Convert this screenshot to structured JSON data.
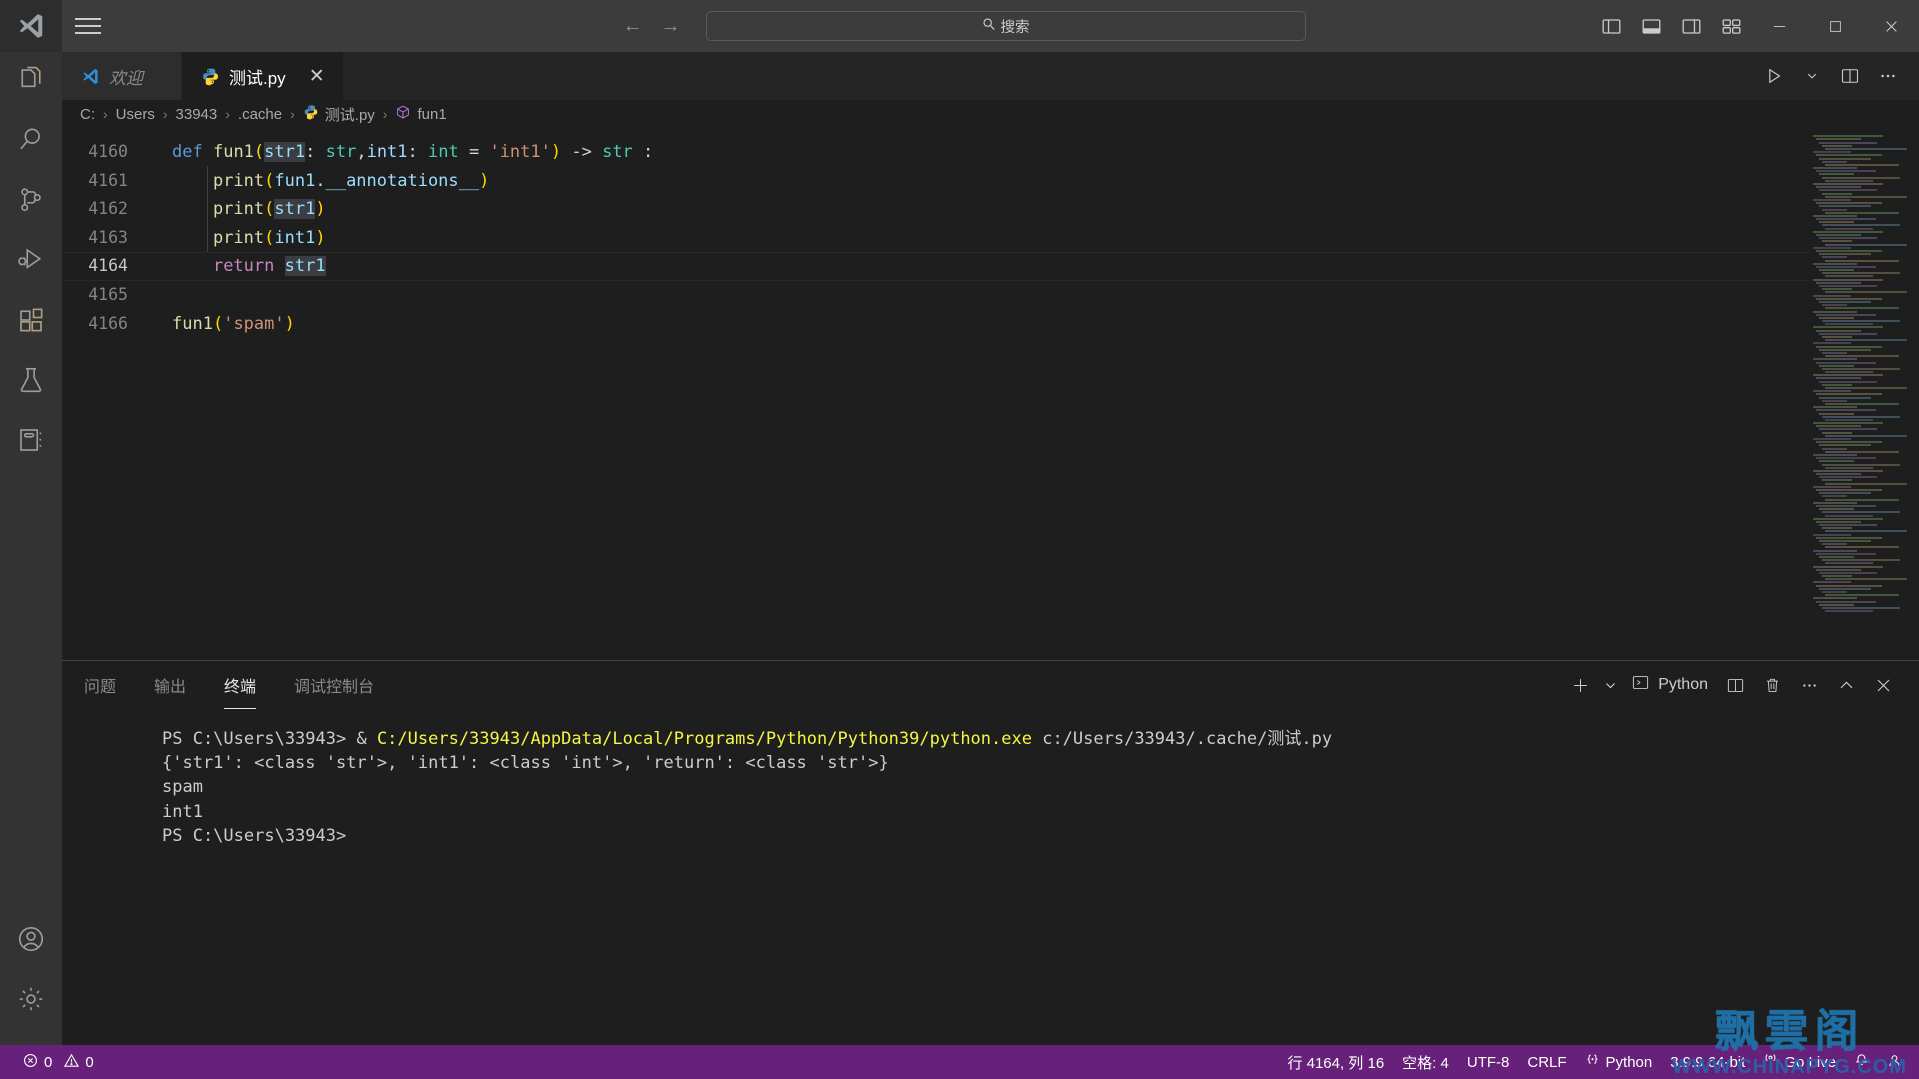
{
  "titlebar": {
    "logo_icon": "vscode-logo-icon",
    "menu_icon": "hamburger-menu-icon",
    "back_label": "←",
    "forward_label": "→",
    "search_placeholder": "搜索",
    "search_icon": "search-icon",
    "layout_icons": [
      "toggle-primary-sidebar-icon",
      "toggle-panel-icon",
      "toggle-secondary-sidebar-icon",
      "customize-layout-icon"
    ],
    "window_minimize": "minimize-icon",
    "window_maximize": "maximize-icon",
    "window_close": "close-icon"
  },
  "activitybar": {
    "items": [
      {
        "name": "explorer",
        "icon": "files-icon"
      },
      {
        "name": "search",
        "icon": "search-icon"
      },
      {
        "name": "source-control",
        "icon": "source-control-icon"
      },
      {
        "name": "run-and-debug",
        "icon": "run-debug-icon"
      },
      {
        "name": "extensions",
        "icon": "extensions-icon"
      },
      {
        "name": "testing",
        "icon": "beaker-icon"
      },
      {
        "name": "jupyter",
        "icon": "notebook-icon"
      }
    ],
    "bottom": [
      {
        "name": "accounts",
        "icon": "account-icon"
      },
      {
        "name": "manage",
        "icon": "gear-icon"
      }
    ]
  },
  "tabs": [
    {
      "label": "欢迎",
      "icon": "vscode-logo-icon",
      "active": false,
      "italic": true,
      "closable": false
    },
    {
      "label": "测试.py",
      "icon": "python-icon",
      "active": true,
      "italic": false,
      "closable": true,
      "close_label": "✕"
    }
  ],
  "editor_actions": {
    "run_label": "run-python-file-icon",
    "run_chevron": "chevron-down-icon",
    "split_editor": "split-editor-right-icon",
    "more_actions": "more-actions-icon"
  },
  "breadcrumb": {
    "items": [
      {
        "label": "C:",
        "icon": null
      },
      {
        "label": "Users",
        "icon": null
      },
      {
        "label": "33943",
        "icon": null
      },
      {
        "label": ".cache",
        "icon": null
      },
      {
        "label": "测试.py",
        "icon": "python-icon"
      },
      {
        "label": "fun1",
        "icon": "symbol-class-icon"
      }
    ],
    "separator": "›"
  },
  "editor": {
    "language": "python",
    "lines": [
      {
        "number": "4160",
        "current": false,
        "tokens": [
          {
            "t": "def",
            "c": "kw"
          },
          {
            "t": " ",
            "c": "op"
          },
          {
            "t": "fun1",
            "c": "fn"
          },
          {
            "t": "(",
            "c": "p1"
          },
          {
            "t": "str1",
            "c": "var sel"
          },
          {
            "t": ": ",
            "c": "op"
          },
          {
            "t": "str",
            "c": "type"
          },
          {
            "t": ",",
            "c": "op"
          },
          {
            "t": "int1",
            "c": "var"
          },
          {
            "t": ": ",
            "c": "op"
          },
          {
            "t": "int",
            "c": "type"
          },
          {
            "t": " = ",
            "c": "op"
          },
          {
            "t": "'int1'",
            "c": "str"
          },
          {
            "t": ")",
            "c": "p1"
          },
          {
            "t": " -> ",
            "c": "op"
          },
          {
            "t": "str",
            "c": "type"
          },
          {
            "t": " :",
            "c": "op"
          }
        ]
      },
      {
        "number": "4161",
        "current": false,
        "tokens": [
          {
            "t": "    ",
            "c": "op"
          },
          {
            "t": "print",
            "c": "fn"
          },
          {
            "t": "(",
            "c": "p1"
          },
          {
            "t": "fun1",
            "c": "var"
          },
          {
            "t": ".",
            "c": "op"
          },
          {
            "t": "__annotations__",
            "c": "var"
          },
          {
            "t": ")",
            "c": "p1"
          }
        ]
      },
      {
        "number": "4162",
        "current": false,
        "tokens": [
          {
            "t": "    ",
            "c": "op"
          },
          {
            "t": "print",
            "c": "fn"
          },
          {
            "t": "(",
            "c": "p1"
          },
          {
            "t": "str1",
            "c": "var sel"
          },
          {
            "t": ")",
            "c": "p1"
          }
        ]
      },
      {
        "number": "4163",
        "current": false,
        "tokens": [
          {
            "t": "    ",
            "c": "op"
          },
          {
            "t": "print",
            "c": "fn"
          },
          {
            "t": "(",
            "c": "p1"
          },
          {
            "t": "int1",
            "c": "var"
          },
          {
            "t": ")",
            "c": "p1"
          }
        ]
      },
      {
        "number": "4164",
        "current": true,
        "tokens": [
          {
            "t": "    ",
            "c": "op"
          },
          {
            "t": "return",
            "c": "kwc"
          },
          {
            "t": " ",
            "c": "op"
          },
          {
            "t": "str1",
            "c": "var sel"
          }
        ]
      },
      {
        "number": "4165",
        "current": false,
        "tokens": []
      },
      {
        "number": "4166",
        "current": false,
        "tokens": [
          {
            "t": "fun1",
            "c": "fn"
          },
          {
            "t": "(",
            "c": "p1"
          },
          {
            "t": "'spam'",
            "c": "str"
          },
          {
            "t": ")",
            "c": "p1"
          }
        ]
      }
    ]
  },
  "panel": {
    "tabs": [
      {
        "label": "问题",
        "active": false
      },
      {
        "label": "输出",
        "active": false
      },
      {
        "label": "终端",
        "active": true
      },
      {
        "label": "调试控制台",
        "active": false
      }
    ],
    "actions": {
      "new_terminal": "add-icon",
      "new_terminal_chevron": "chevron-down-icon",
      "shell_icon": "terminal-chevron-icon",
      "shell_label": "Python",
      "split_terminal": "split-terminal-icon",
      "kill_terminal": "trash-icon",
      "more": "more-actions-icon",
      "maximize": "chevron-up-icon",
      "close": "close-icon"
    },
    "terminal_lines": [
      [
        {
          "t": "PS C:\\Users\\33943> & ",
          "c": "t-white"
        },
        {
          "t": "C:/Users/33943/AppData/Local/Programs/Python/Python39/python.exe",
          "c": "t-yellow"
        },
        {
          "t": " c:/Users/33943/.cache/测试.py",
          "c": "t-white"
        }
      ],
      [
        {
          "t": "{'str1': <class 'str'>, 'int1': <class 'int'>, 'return': <class 'str'>}",
          "c": "t-white"
        }
      ],
      [
        {
          "t": "spam",
          "c": "t-white"
        }
      ],
      [
        {
          "t": "int1",
          "c": "t-white"
        }
      ],
      [
        {
          "t": "PS C:\\Users\\33943>",
          "c": "t-white"
        }
      ]
    ]
  },
  "statusbar": {
    "errors_icon": "error-circle-icon",
    "errors_count": "0",
    "warnings_icon": "warning-triangle-icon",
    "warnings_count": "0",
    "line_col": "行 4164, 列 16",
    "spaces": "空格: 4",
    "encoding": "UTF-8",
    "eol": "CRLF",
    "language_icon": "python-brackets-icon",
    "language": "Python",
    "interpreter": "3.9.9 64-bit",
    "golive_icon": "broadcast-icon",
    "golive": "Go Live",
    "bell_icon": "bell-icon",
    "account_icon": "account-icon",
    "background_color": "#68217a"
  },
  "watermark": {
    "chinese": "飘雲阁",
    "url": "WWW.CHINAPYG.COM",
    "color_cn": "#1d6fa5",
    "color_url": "#2a5fa8"
  }
}
